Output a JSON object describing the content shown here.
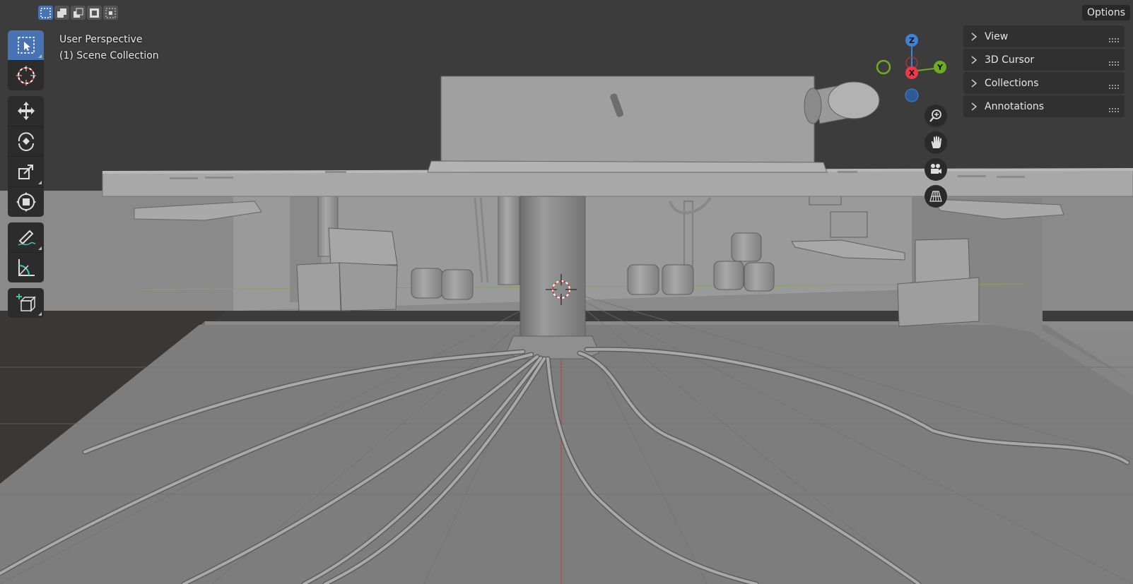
{
  "header": {
    "select_modes": [
      "select-new-icon",
      "select-extend-icon",
      "select-subtract-icon",
      "select-invert-icon",
      "select-intersect-icon"
    ],
    "options_label": "Options"
  },
  "overlay": {
    "view_name": "User Perspective",
    "collection": "(1) Scene Collection"
  },
  "toolbar": {
    "tools": [
      "select-box-icon",
      "cursor-icon",
      "move-icon",
      "rotate-icon",
      "scale-icon",
      "transform-icon",
      "annotate-icon",
      "measure-icon",
      "add-cube-icon"
    ]
  },
  "gizmo": {
    "z": "Z",
    "x": "X",
    "y": "Y",
    "colors": {
      "x": "#f0384d",
      "y": "#6fac23",
      "z": "#3e82d8"
    }
  },
  "side_panel": {
    "items": [
      {
        "label": "View"
      },
      {
        "label": "3D Cursor"
      },
      {
        "label": "Collections"
      },
      {
        "label": "Annotations"
      }
    ]
  },
  "colors": {
    "accent": "#4772b3",
    "background": "#3a3a3a",
    "floor": "#7c7c7c"
  }
}
